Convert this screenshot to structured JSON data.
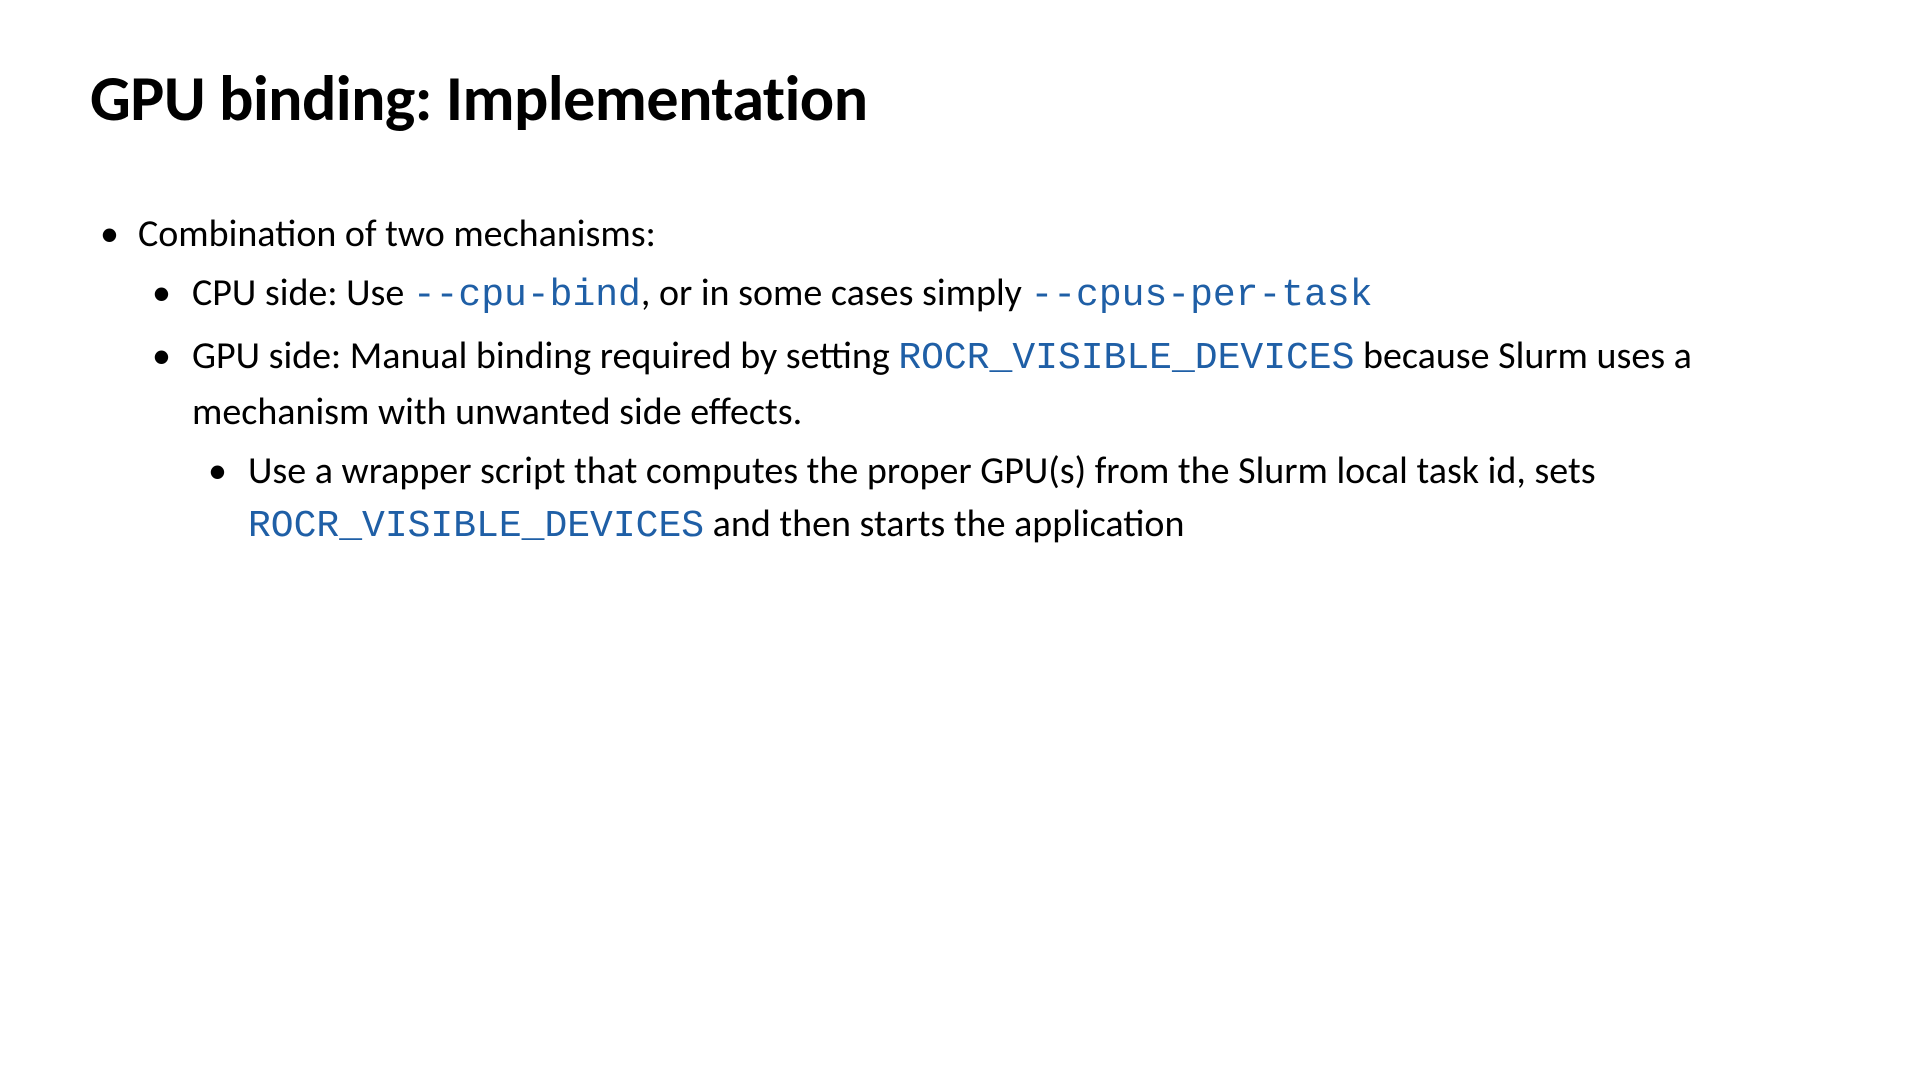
{
  "title": "GPU binding: Implementation",
  "bullets": {
    "l1_1": "Combination of two mechanisms:",
    "l2_1_pre": "CPU side: Use ",
    "l2_1_code1": "--cpu-bind",
    "l2_1_mid": ", or in some cases simply ",
    "l2_1_code2": "--cpus-per-task",
    "l2_2_pre": "GPU side: Manual binding required by setting ",
    "l2_2_code1": "ROCR_VISIBLE_DEVICES",
    "l2_2_post": " because Slurm uses a mechanism with unwanted side effects.",
    "l3_1_pre": "Use a wrapper script that computes the proper GPU(s) from the Slurm local task id, sets ",
    "l3_1_code1": "ROCR_VISIBLE_DEVICES",
    "l3_1_post": " and then starts the application"
  }
}
